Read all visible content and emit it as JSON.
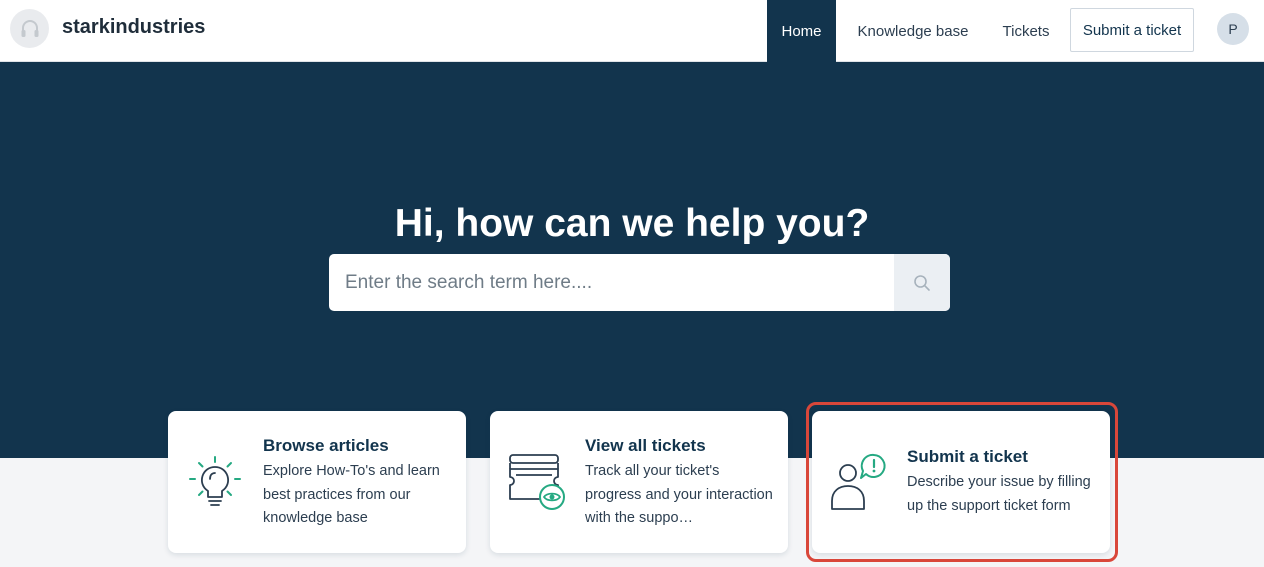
{
  "header": {
    "brand": "starkindustries",
    "logo_icon": "headset-icon",
    "nav": {
      "home": "Home",
      "knowledge_base": "Knowledge base",
      "tickets": "Tickets",
      "submit_ticket": "Submit a ticket"
    },
    "avatar_initial": "P"
  },
  "hero": {
    "title": "Hi, how can we help you?",
    "search_placeholder": "Enter the search term here....",
    "search_value": "",
    "search_icon": "search-icon"
  },
  "cards": [
    {
      "icon": "lightbulb-icon",
      "title": "Browse articles",
      "description": "Explore How-To's and learn best practices from our knowledge base"
    },
    {
      "icon": "tickets-eye-icon",
      "title": "View all tickets",
      "description": "Track all your ticket's progress and your interaction with the suppo…"
    },
    {
      "icon": "user-alert-icon",
      "title": "Submit a ticket",
      "description": "Describe your issue by filling up the support ticket form"
    }
  ],
  "colors": {
    "navy": "#12344d",
    "accent_green": "#25a982",
    "highlight_red": "#d9473a",
    "page_bg": "#f4f5f7"
  }
}
